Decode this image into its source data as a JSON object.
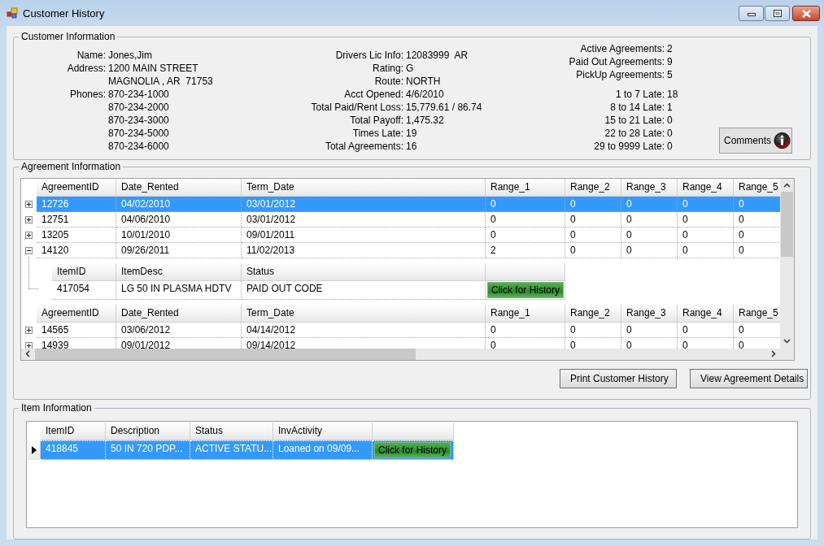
{
  "window": {
    "title": "Customer History"
  },
  "customer_information": {
    "title": "Customer Information",
    "personal": [
      {
        "label": "Name:",
        "values": [
          "Jones,Jim"
        ]
      },
      {
        "label": "Address:",
        "values": [
          "1200 MAIN STREET",
          "MAGNOLIA , AR  71753"
        ]
      },
      {
        "label": "Phones:",
        "values": [
          "870-234-1000",
          "870-234-2000",
          "870-234-3000",
          "870-234-5000",
          "870-234-6000"
        ]
      }
    ],
    "account": [
      {
        "label": "Drivers Lic Info:",
        "value": "12083999  AR"
      },
      {
        "label": "Rating:",
        "value": "G"
      },
      {
        "label": "Route:",
        "value": "NORTH"
      },
      {
        "label": "Acct Opened:",
        "value": "4/6/2010"
      },
      {
        "label": "Total Paid/Rent Loss:",
        "value": "15,779.61 / 86.74"
      },
      {
        "label": "Total Payoff:",
        "value": "1,475.32"
      },
      {
        "label": "Times Late:",
        "value": "19"
      },
      {
        "label": "Total Agreements:",
        "value": "16"
      }
    ],
    "agreement_counts": [
      {
        "label": "Active Agreements:",
        "value": "2"
      },
      {
        "label": "Paid Out Agreements:",
        "value": "9"
      },
      {
        "label": "PickUp Agreements:",
        "value": "5"
      }
    ],
    "late_counts": [
      {
        "label": "1 to 7 Late:",
        "value": "18"
      },
      {
        "label": "8 to 14 Late:",
        "value": "1"
      },
      {
        "label": "15 to 21 Late:",
        "value": "0"
      },
      {
        "label": "22 to 28 Late:",
        "value": "0"
      },
      {
        "label": "29 to 9999 Late:",
        "value": "0"
      }
    ],
    "comments_button": "Comments"
  },
  "agreement_information": {
    "title": "Agreement Information",
    "bands": [
      {
        "columns": [
          "AgreementID",
          "Date_Rented",
          "Term_Date",
          "Range_1",
          "Range_2",
          "Range_3",
          "Range_4",
          "Range_5"
        ],
        "rows": [
          {
            "selected": true,
            "expanded": false,
            "cells": [
              "12726",
              "04/02/2010",
              "03/01/2012",
              "0",
              "0",
              "0",
              "0",
              "0"
            ]
          },
          {
            "selected": false,
            "expanded": false,
            "cells": [
              "12751",
              "04/06/2010",
              "03/01/2012",
              "0",
              "0",
              "0",
              "0",
              "0"
            ]
          },
          {
            "selected": false,
            "expanded": false,
            "cells": [
              "13205",
              "10/01/2010",
              "09/01/2011",
              "0",
              "0",
              "0",
              "0",
              "0"
            ]
          },
          {
            "selected": false,
            "expanded": true,
            "cells": [
              "14120",
              "09/26/2011",
              "11/02/2013",
              "2",
              "0",
              "0",
              "0",
              "0"
            ],
            "items": {
              "columns": [
                "ItemID",
                "ItemDesc",
                "Status"
              ],
              "rows": [
                {
                  "cells": [
                    "417054",
                    "LG 50 IN PLASMA HDTV",
                    "PAID OUT CODE"
                  ],
                  "action": "Click for History"
                }
              ]
            }
          }
        ]
      },
      {
        "columns": [
          "AgreementID",
          "Date_Rented",
          "Term_Date",
          "Range_1",
          "Range_2",
          "Range_3",
          "Range_4",
          "Range_5"
        ],
        "rows": [
          {
            "selected": false,
            "expanded": false,
            "cells": [
              "14565",
              "03/06/2012",
              "04/14/2012",
              "0",
              "0",
              "0",
              "0",
              "0"
            ]
          },
          {
            "selected": false,
            "expanded": false,
            "cells": [
              "14939",
              "09/01/2012",
              "09/14/2012",
              "0",
              "0",
              "0",
              "0",
              "0"
            ]
          }
        ]
      }
    ],
    "buttons": [
      "Print Customer History",
      "View Agreement Details"
    ]
  },
  "item_information": {
    "title": "Item Information",
    "columns": [
      "ItemID",
      "Description",
      "Status",
      "InvActivity"
    ],
    "rows": [
      {
        "selected": true,
        "current": true,
        "cells": [
          "418845",
          "50 IN 720 PDP...",
          "ACTIVE STATU...",
          "Loaned on 09/09..."
        ],
        "action": "Click for History"
      }
    ]
  }
}
